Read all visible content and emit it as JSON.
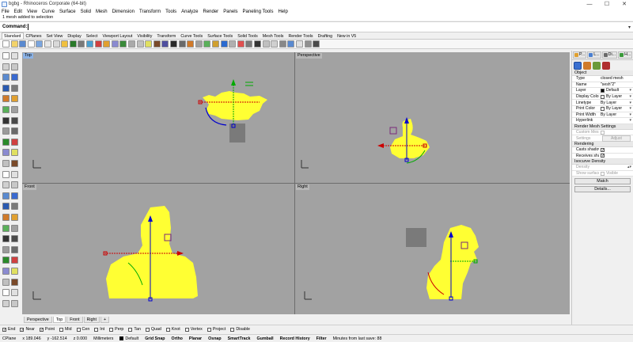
{
  "window": {
    "title": "bgbg - Rhinoceros Corporate (64-bit)",
    "controls": {
      "minimize": "—",
      "maximize": "☐",
      "close": "✕"
    }
  },
  "menu": [
    "File",
    "Edit",
    "View",
    "Curve",
    "Surface",
    "Solid",
    "Mesh",
    "Dimension",
    "Transform",
    "Tools",
    "Analyze",
    "Render",
    "Panels",
    "Paneling Tools",
    "Help"
  ],
  "command": {
    "history": "1 mesh added to selection",
    "prompt": "Command:",
    "arrow": "▾"
  },
  "toolbar_tabs": [
    "Standard",
    "CPlanes",
    "Set View",
    "Display",
    "Select",
    "Viewport Layout",
    "Visibility",
    "Transform",
    "Curve Tools",
    "Surface Tools",
    "Solid Tools",
    "Mesh Tools",
    "Render Tools",
    "Drafting",
    "New in V5"
  ],
  "viewports": [
    {
      "title": "Top",
      "active": true
    },
    {
      "title": "Perspective",
      "active": false
    },
    {
      "title": "Front",
      "active": false
    },
    {
      "title": "Right",
      "active": false
    }
  ],
  "viewport_tabs": [
    "Perspective",
    "Top",
    "Front",
    "Right",
    "+"
  ],
  "osnaps": [
    {
      "label": "End",
      "checked": true
    },
    {
      "label": "Near",
      "checked": true
    },
    {
      "label": "Point",
      "checked": true
    },
    {
      "label": "Mid",
      "checked": false
    },
    {
      "label": "Cen",
      "checked": false
    },
    {
      "label": "Int",
      "checked": false
    },
    {
      "label": "Perp",
      "checked": false
    },
    {
      "label": "Tan",
      "checked": false
    },
    {
      "label": "Quad",
      "checked": false
    },
    {
      "label": "Knot",
      "checked": false
    },
    {
      "label": "Vertex",
      "checked": false
    },
    {
      "label": "Project",
      "checked": false
    },
    {
      "label": "Disable",
      "checked": false
    }
  ],
  "status": {
    "cplane": "CPlane",
    "x": "x 189.046",
    "y": "y -162.514",
    "z": "z 0.000",
    "units": "Millimeters",
    "layer": "Default",
    "toggles": [
      "Grid Snap",
      "Ortho",
      "Planar",
      "Osnap",
      "SmartTrack",
      "Gumball",
      "Record History",
      "Filter"
    ],
    "message": "Minutes from last save: 88"
  },
  "panel": {
    "tabs": [
      {
        "label": "P...",
        "color": "#e0a030"
      },
      {
        "label": "L...",
        "color": "#4a7fd0"
      },
      {
        "label": "Di...",
        "color": "#6a6a6a"
      },
      {
        "label": "H...",
        "color": "#3a9a3a"
      }
    ],
    "object_header": "Object",
    "rows": [
      {
        "k": "Type",
        "v": "closed mesh"
      },
      {
        "k": "Name",
        "v": "\"sesh\"2\""
      },
      {
        "k": "Layer",
        "v": "Default",
        "swatch": "#000000"
      },
      {
        "k": "Display Color",
        "v": "By Layer",
        "swatch": "#ffffff"
      },
      {
        "k": "Linetype",
        "v": "By Layer"
      },
      {
        "k": "Print Color",
        "v": "By Layer",
        "swatch": "#ffffff"
      },
      {
        "k": "Print Width",
        "v": "By Layer"
      },
      {
        "k": "Hyperlink",
        "v": ""
      }
    ],
    "render_mesh_header": "Render Mesh Settings",
    "render_mesh_rows": [
      {
        "k": "Custom Mesh",
        "v": ""
      },
      {
        "k": "Settings",
        "v": "Adjust"
      }
    ],
    "rendering_header": "Rendering",
    "rendering_rows": [
      {
        "k": "Casts shadows",
        "v": "✓"
      },
      {
        "k": "Receives sha...",
        "v": "✓"
      }
    ],
    "isocurve_header": "Isocurve Density",
    "isocurve_rows": [
      {
        "k": "Density",
        "v": ""
      },
      {
        "k": "Show surface ...",
        "v": "Visible"
      }
    ],
    "match_button": "Match",
    "details_button": "Details..."
  }
}
